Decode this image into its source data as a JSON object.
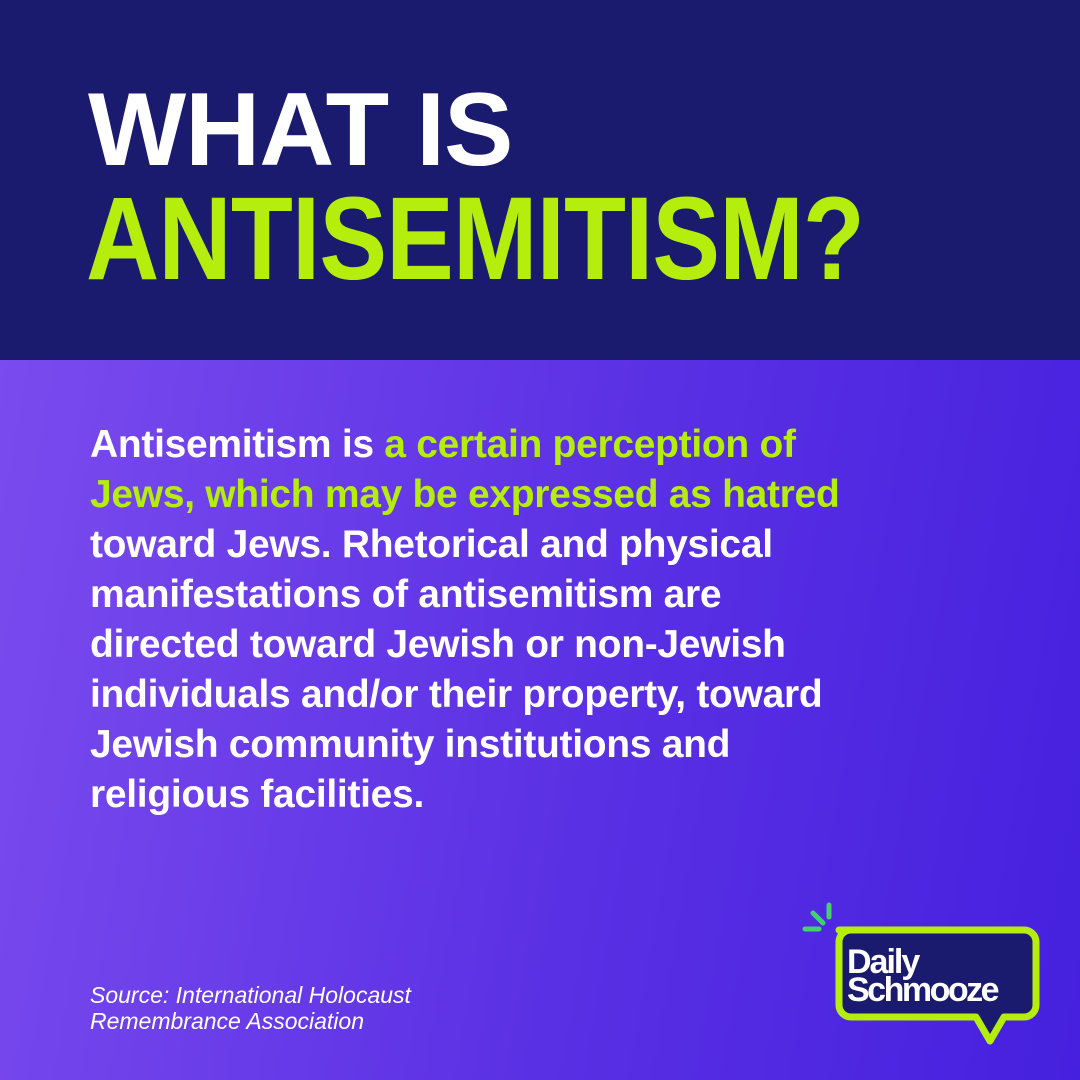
{
  "title": {
    "line1": "WHAT IS",
    "line2": "ANTISEMITISM?"
  },
  "body": {
    "lines": [
      [
        {
          "t": "Antisemitism is ",
          "hl": false
        },
        {
          "t": "a certain perception of",
          "hl": true
        }
      ],
      [
        {
          "t": "Jews, which may be expressed as hatred",
          "hl": true
        }
      ],
      [
        {
          "t": "toward Jews. Rhetorical and physical",
          "hl": false
        }
      ],
      [
        {
          "t": "manifestations of antisemitism are",
          "hl": false
        }
      ],
      [
        {
          "t": "directed toward Jewish or non-Jewish",
          "hl": false
        }
      ],
      [
        {
          "t": "individuals and/or their property, toward",
          "hl": false
        }
      ],
      [
        {
          "t": "Jewish community institutions and",
          "hl": false
        }
      ],
      [
        {
          "t": "religious facilities.",
          "hl": false
        }
      ]
    ]
  },
  "source": {
    "line1": "Source: International Holocaust",
    "line2": "Remembrance Association"
  },
  "logo": {
    "line1": "Daily",
    "line2": "Schmooze"
  },
  "colors": {
    "navy": "#1a1a6e",
    "lime": "#b5ee0c",
    "purple_left": "#7a4bee",
    "purple_right": "#4520de"
  }
}
